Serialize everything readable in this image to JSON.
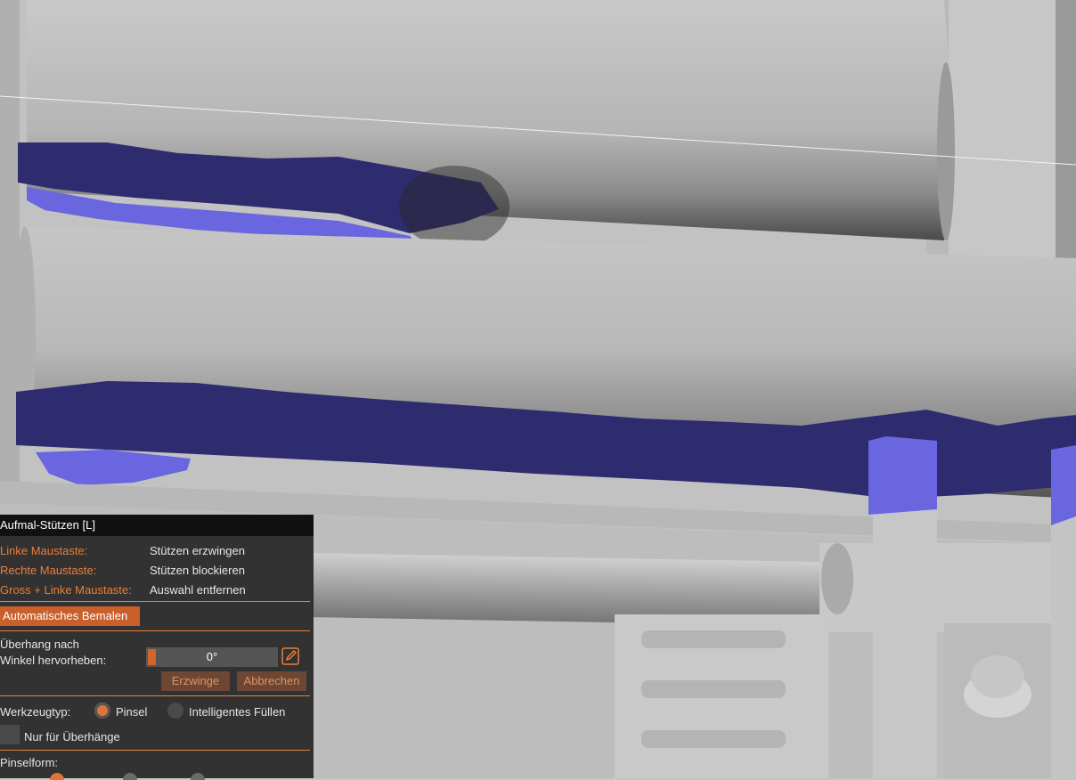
{
  "panel": {
    "title": "Aufmal-Stützen [L]",
    "shortcuts": [
      {
        "key": "Linke Maustaste:",
        "action": "Stützen erzwingen"
      },
      {
        "key": "Rechte Maustaste:",
        "action": "Stützen blockieren"
      },
      {
        "key": "Gross + Linke Maustaste:",
        "action": "Auswahl entfernen"
      }
    ],
    "auto_paint_label": "Automatisches Bemalen",
    "overhang_label_1": "Überhang nach",
    "overhang_label_2": "Winkel hervorheben:",
    "overhang_angle": "0°",
    "overhang_fraction": 0,
    "enforce_label": "Erzwinge",
    "cancel_label": "Abbrechen",
    "tool_type_label": "Werkzeugtyp:",
    "tool_options": [
      {
        "label": "Pinsel",
        "selected": true
      },
      {
        "label": "Intelligentes Füllen",
        "selected": false
      }
    ],
    "overhang_only_label": "Nur für Überhänge",
    "brush_shape_label": "Pinselform:",
    "icons": {
      "edit": "pencil-icon"
    }
  },
  "colors": {
    "accent": "#ea7e3a",
    "paint_enforced": "#6a66e0",
    "paint_dark": "#2e2c6e"
  }
}
